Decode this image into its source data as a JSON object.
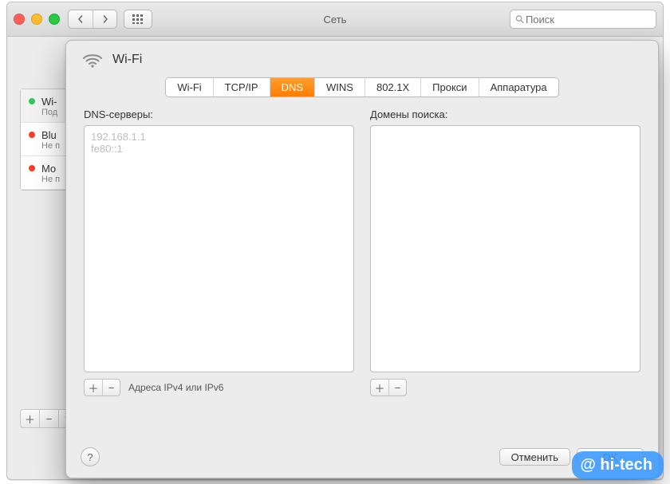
{
  "window": {
    "title": "Сеть",
    "search_placeholder": "Поиск"
  },
  "sidebar": {
    "items": [
      {
        "name": "Wi-",
        "status_text": "Под",
        "dot": "green",
        "selected": true
      },
      {
        "name": "Blu",
        "status_text": "Не п",
        "dot": "red",
        "selected": false
      },
      {
        "name": "Mo",
        "status_text": "Не п",
        "dot": "red",
        "selected": false
      }
    ]
  },
  "sheet": {
    "header_title": "Wi-Fi",
    "tabs": [
      "Wi-Fi",
      "TCP/IP",
      "DNS",
      "WINS",
      "802.1X",
      "Прокси",
      "Аппаратура"
    ],
    "active_tab_index": 2,
    "dns": {
      "label": "DNS-серверы:",
      "servers": [
        "192.168.1.1",
        "fe80::1"
      ],
      "hint": "Адреса IPv4 или IPv6"
    },
    "search_domains": {
      "label": "Домены поиска:",
      "domains": []
    },
    "buttons": {
      "cancel": "Отменить",
      "ok": "OK"
    }
  },
  "watermark": "@ hi-tech"
}
